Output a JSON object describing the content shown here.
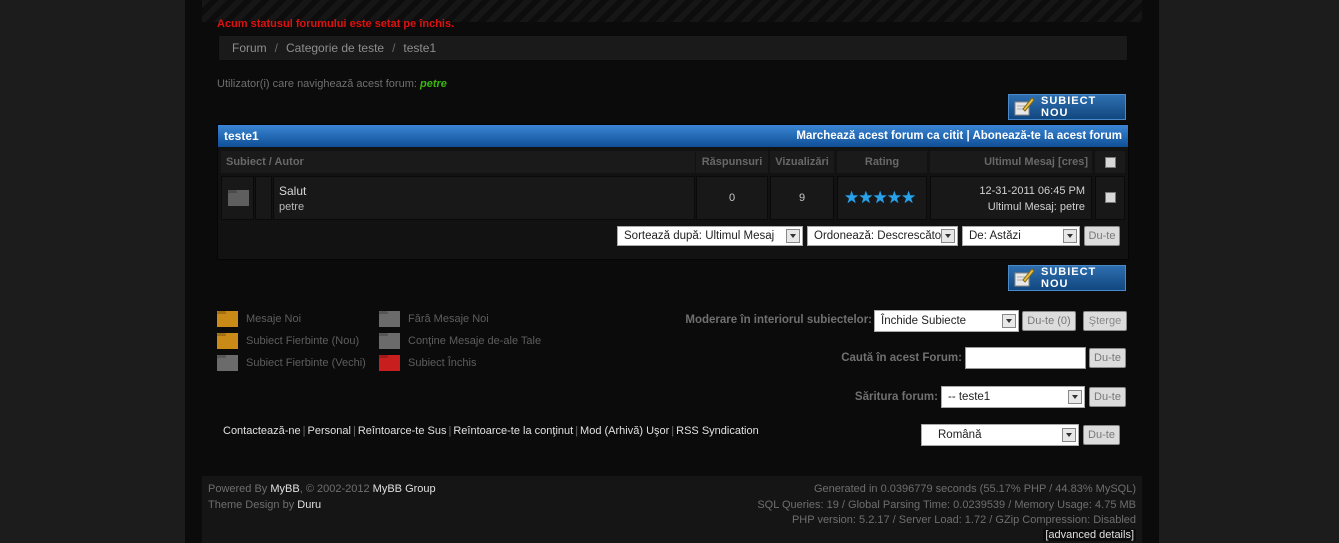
{
  "status_message": "Acum statusul forumului este setat pe închis.",
  "breadcrumb": [
    "Forum",
    "Categorie de teste",
    "teste1"
  ],
  "viewers": {
    "label": "Utilizator(i) care navighează acest forum:",
    "user": "petre"
  },
  "new_thread_button": "SUBIECT NOU",
  "forum": {
    "title": "teste1",
    "mark_read": "Marchează acest forum ca citit",
    "link_sep": "|",
    "subscribe": "Abonează-te la acest forum",
    "columns": {
      "subject": "Subiect / Autor",
      "replies": "Răspunsuri",
      "views": "Vizualizări",
      "rating": "Rating",
      "last_post": "Ultimul Mesaj [cres]"
    },
    "threads": [
      {
        "title": "Salut",
        "author": "petre",
        "replies": "0",
        "views": "9",
        "rating_stars": 5,
        "last_post_date": "12-31-2011 06:45 PM",
        "last_post_by_label": "Ultimul Mesaj:",
        "last_post_by": "petre"
      }
    ]
  },
  "sort": {
    "sort_by": "Sortează după: Ultimul Mesaj",
    "order": "Ordonează: Descrescător",
    "from": "De: Astăzi",
    "go": "Du-te"
  },
  "legend": {
    "new_posts": "Mesaje Noi",
    "no_new_posts": "Fără Mesaje Noi",
    "hot_new": "Subiect Fierbinte (Nou)",
    "contains_yours": "Conţine Mesaje de-ale Tale",
    "hot_old": "Subiect Fierbinte (Vechi)",
    "closed": "Subiect Închis"
  },
  "moderation": {
    "label": "Moderare în interiorul subiectelor:",
    "selected": "Închide Subiecte",
    "go": "Du-te (0)",
    "clear": "Şterge"
  },
  "search": {
    "label": "Caută în acest Forum:",
    "value": "",
    "go": "Du-te"
  },
  "jump": {
    "label": "Săritura forum:",
    "selected": "-- teste1",
    "go": "Du-te"
  },
  "language": {
    "selected": "Română",
    "go": "Du-te"
  },
  "footer_links": [
    "Contactează-ne",
    "Personal",
    "Reîntoarce-te Sus",
    "Reîntoarce-te la conţinut",
    "Mod (Arhivă) Uşor",
    "RSS Syndication"
  ],
  "powered": {
    "prefix": "Powered By",
    "mybb": "MyBB",
    "copy": ", © 2002-2012",
    "group": "MyBB Group"
  },
  "theme": {
    "prefix": "Theme Design by",
    "author": "Duru"
  },
  "stats": {
    "line1": "Generated in 0.0396779 seconds (55.17% PHP / 44.83% MySQL)",
    "line2": "SQL Queries: 19 / Global Parsing Time: 0.0239539 / Memory Usage: 4.75 MB",
    "line3": "PHP version: 5.2.17 / Server Load: 1.72 / GZip Compression: Disabled",
    "advanced": "[advanced details]"
  },
  "colors": {
    "status_red": "#e01010",
    "header_blue": "#1b5fa8",
    "star_blue": "#2aa2e8",
    "viewer_green": "#39b80e",
    "folder_orange": "#c98a18",
    "folder_gray": "#6b6b6b",
    "folder_red": "#c81e1e"
  }
}
